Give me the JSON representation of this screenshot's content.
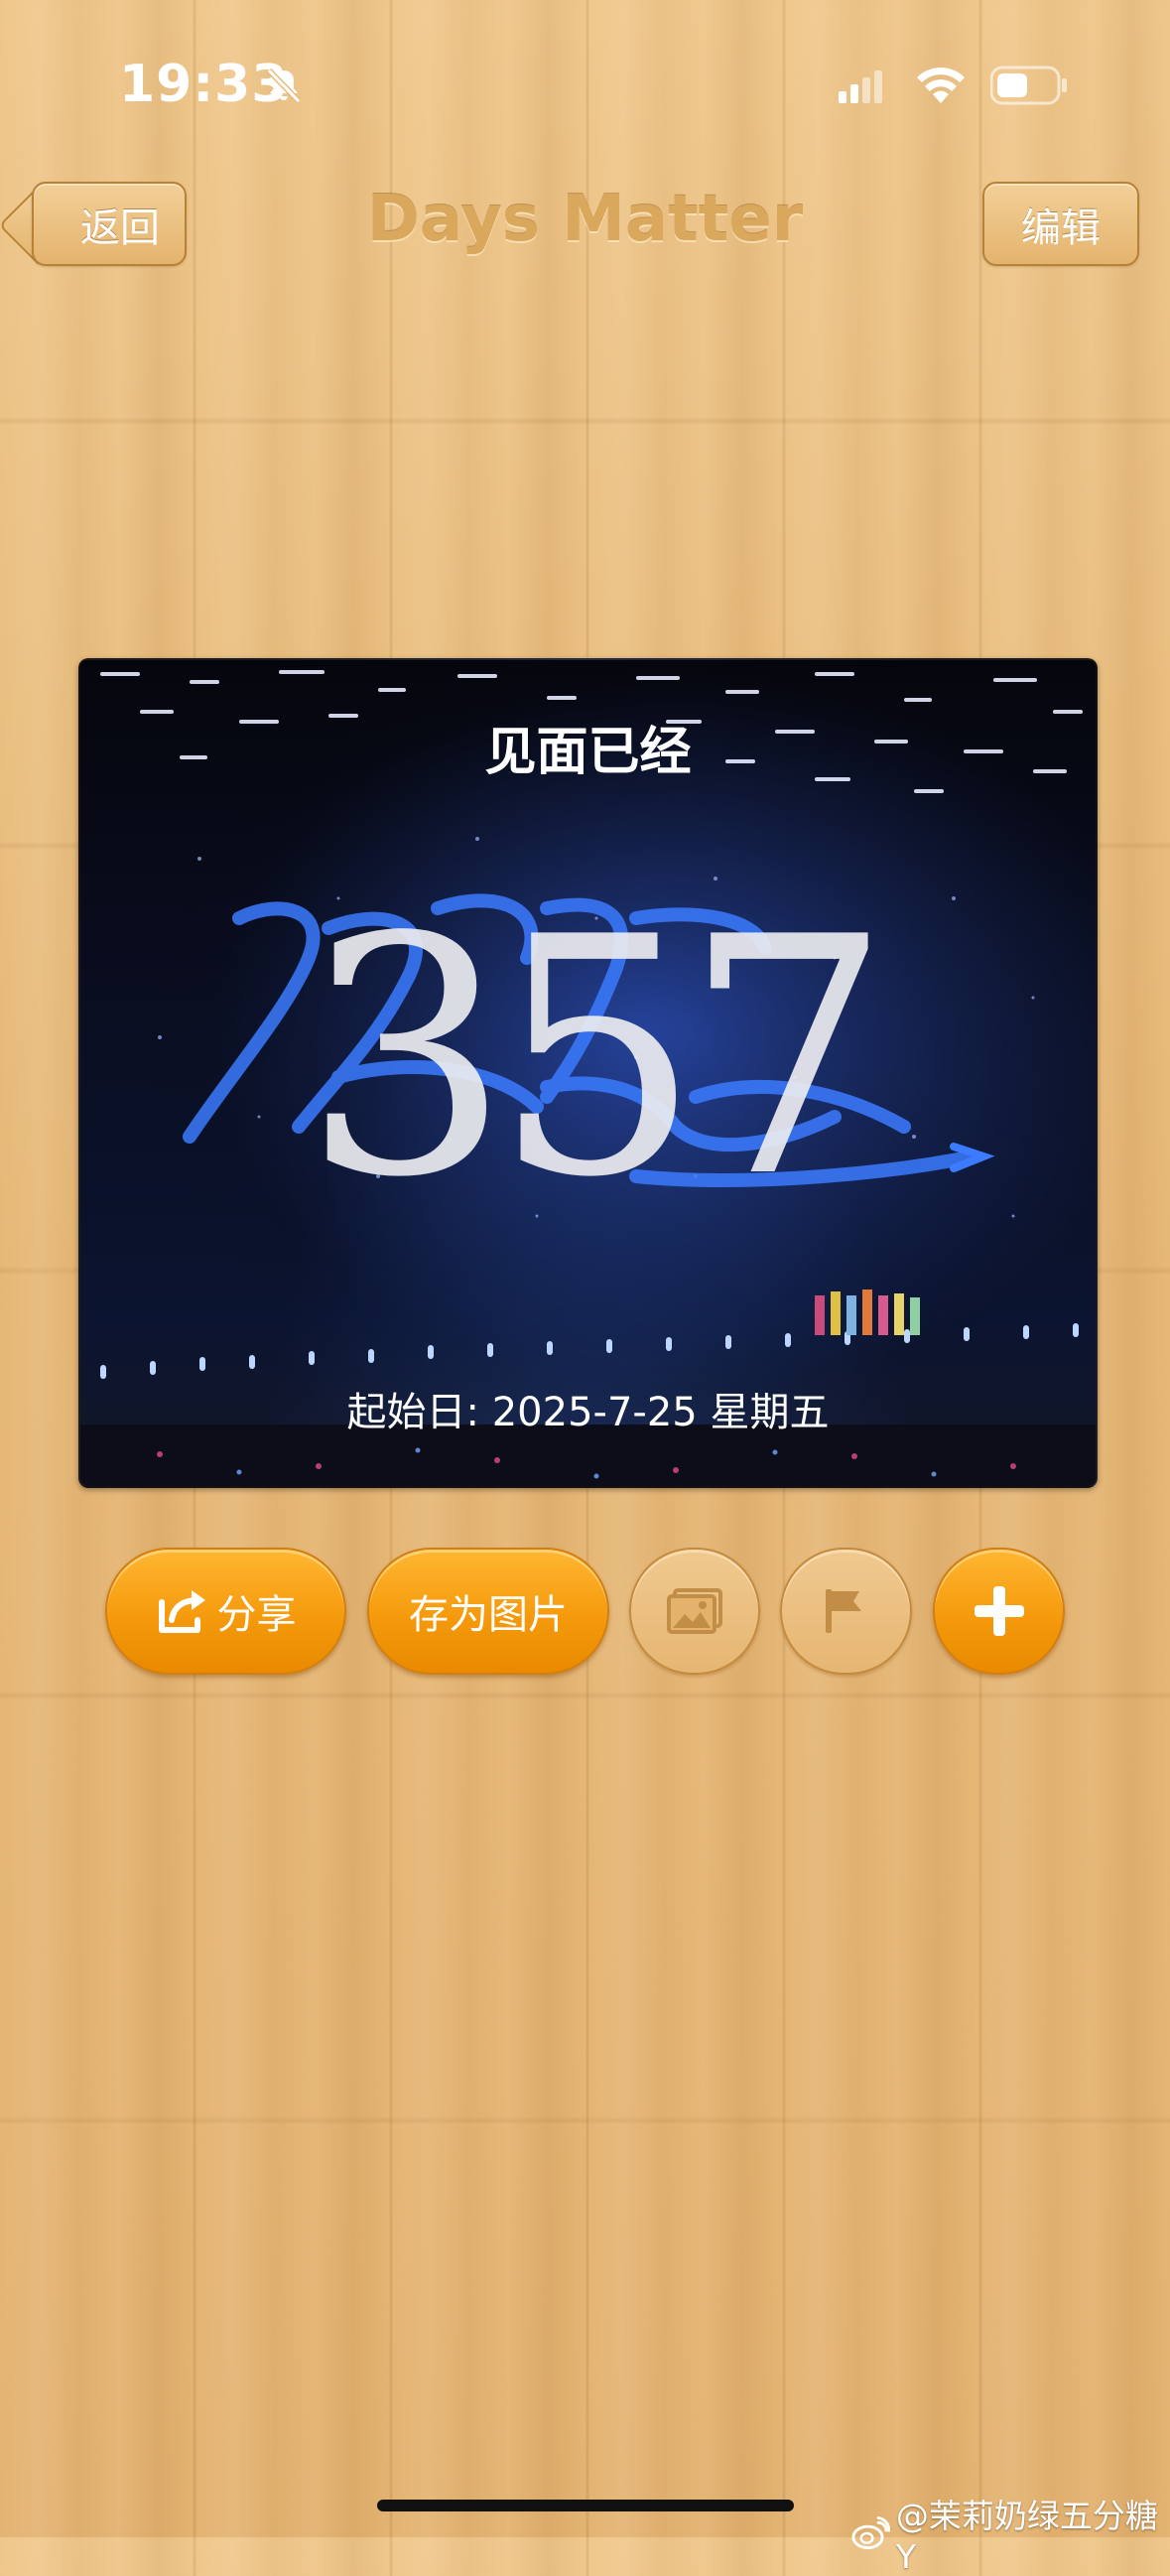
{
  "status_bar": {
    "time": "19:33",
    "icons": [
      "bell-slash-icon",
      "signal-icon",
      "wifi-icon",
      "battery-icon"
    ]
  },
  "nav": {
    "back_label": "返回",
    "title": "Days Matter",
    "edit_label": "编辑"
  },
  "card": {
    "heading": "见面已经",
    "days": "357",
    "start_date": "起始日: 2025-7-25 星期五",
    "background": "concert-stage-photo"
  },
  "actions": {
    "share_label": "分享",
    "save_image_label": "存为图片",
    "icons": [
      "share-icon",
      "photo-icon",
      "flag-icon",
      "plus-icon"
    ]
  },
  "watermark": {
    "text": "@茉莉奶绿五分糖Y",
    "icon": "weibo-icon"
  },
  "colors": {
    "accent_orange": "#f59a0c",
    "title_tan": "#d9a85c",
    "wood_base": "#e8bd7e"
  }
}
